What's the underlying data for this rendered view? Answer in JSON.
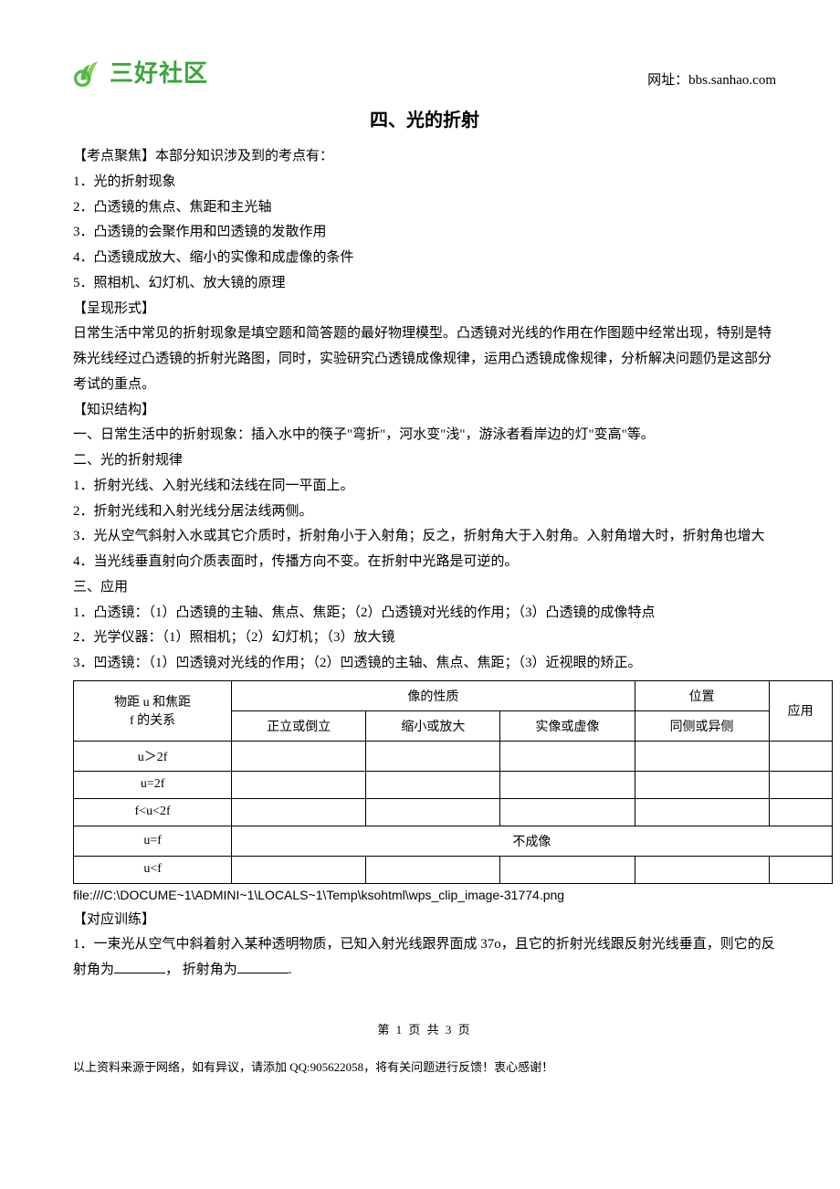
{
  "logo_text": "三好社区",
  "site_url": "网址：bbs.sanhao.com",
  "doc_title": "四、光的折射",
  "body": {
    "focus_label": "【考点聚焦】本部分知识涉及到的考点有：",
    "focus_items": [
      "1．光的折射现象",
      "2．凸透镜的焦点、焦距和主光轴",
      "3．凸透镜的会聚作用和凹透镜的发散作用",
      "4．凸透镜成放大、缩小的实像和成虚像的条件",
      "5．照相机、幻灯机、放大镜的原理"
    ],
    "form_label": "【呈现形式】",
    "form_text": "日常生活中常见的折射现象是填空题和简答题的最好物理模型。凸透镜对光线的作用在作图题中经常出现，特别是特殊光线经过凸透镜的折射光路图，同时，实验研究凸透镜成像规律，运用凸透镜成像规律，分析解决问题仍是这部分考试的重点。",
    "struct_label": "【知识结构】",
    "struct_lines": [
      "一、日常生活中的折射现象：插入水中的筷子\"弯折\"，河水变\"浅\"，游泳者看岸边的灯\"变高\"等。",
      "二、光的折射规律",
      "1．折射光线、入射光线和法线在同一平面上。",
      "2．折射光线和入射光线分居法线两侧。",
      "3．光从空气斜射入水或其它介质时，折射角小于入射角；反之，折射角大于入射角。入射角增大时，折射角也增大",
      "4．当光线垂直射向介质表面时，传播方向不变。在折射中光路是可逆的。",
      "三、应用",
      "1．凸透镜：（1）凸透镜的主轴、焦点、焦距；（2）凸透镜对光线的作用；（3）凸透镜的成像特点",
      "2．光学仪器：（1）照相机；（2）幻灯机；（3）放大镜",
      "3．凹透镜：（1）凹透镜对光线的作用；（2）凹透镜的主轴、焦点、焦距；（3）近视眼的矫正。"
    ]
  },
  "table": {
    "col0_line1": "物距 u 和焦距",
    "col0_line2": "f 的关系",
    "merged_header": "像的性质",
    "col4_header": "位置",
    "col5_header": "应用",
    "sub_headers": [
      "正立或倒立",
      "缩小或放大",
      "实像或虚像",
      "同侧或异侧"
    ],
    "rows": [
      {
        "c0": "u＞2f",
        "c1": "",
        "c2": "",
        "c3": "",
        "c4": "",
        "c5": ""
      },
      {
        "c0": "u=2f",
        "c1": "",
        "c2": "",
        "c3": "",
        "c4": "",
        "c5": ""
      },
      {
        "c0": "f<u<2f",
        "c1": "",
        "c2": "",
        "c3": "",
        "c4": "",
        "c5": ""
      },
      {
        "c0": "u=f",
        "merged": "不成像"
      },
      {
        "c0": "u<f",
        "c1": "",
        "c2": "",
        "c3": "",
        "c4": "",
        "c5": ""
      }
    ]
  },
  "file_path": "file:///C:\\DOCUME~1\\ADMINI~1\\LOCALS~1\\Temp\\ksohtml\\wps_clip_image-31774.png",
  "training_label": "【对应训练】",
  "q1_a": "1．一束光从空气中斜着射入某种透明物质，已知入射光线跟界面成 37o，且它的折射光线跟反射光线垂直，则它的反射角为",
  "q1_b": "，  折射角为",
  "q1_c": ".",
  "page_num": "第  1  页  共  3  页",
  "footer": "以上资料来源于网络，如有异议，请添加 QQ:905622058，将有关问题进行反馈！衷心感谢！"
}
